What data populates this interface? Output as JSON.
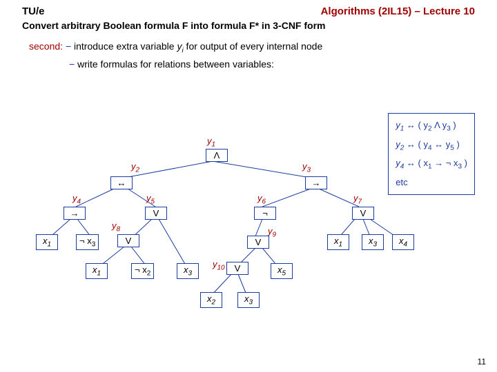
{
  "header": {
    "org": "TU/e",
    "course": "Algorithms (2IL15) – Lecture 10"
  },
  "title": "Convert arbitrary Boolean formula F into formula F* in 3-CNF form",
  "step": {
    "label": "second:",
    "b1": "introduce extra variable ",
    "b1_var": "y",
    "b1_sub": "i",
    "b1_tail": " for output of every internal node",
    "b2": "write formulas for relations between variables:"
  },
  "formulas": {
    "f1a": "y",
    "f1as": "1",
    "f1b": " ↔ ( y",
    "f1bs": "2",
    "f1c": " Λ y",
    "f1cs": "3",
    "f1d": " )",
    "f2a": "y",
    "f2as": "2",
    "f2b": " ↔ ( y",
    "f2bs": "4",
    "f2c": " ↔ y",
    "f2cs": "5",
    "f2d": " )",
    "f3a": "y",
    "f3as": "4",
    "f3b": " ↔ ( x",
    "f3bs": "1",
    "f3c": " → ¬ x",
    "f3cs": "3",
    "f3d": " )",
    "etc": "etc"
  },
  "y": {
    "y1": "y",
    "y1s": "1",
    "y2": "y",
    "y2s": "2",
    "y3": "y",
    "y3s": "3",
    "y4": "y",
    "y4s": "4",
    "y5": "y",
    "y5s": "5",
    "y6": "y",
    "y6s": "6",
    "y7": "y",
    "y7s": "7",
    "y8": "y",
    "y8s": "8",
    "y9": "y",
    "y9s": "9",
    "y10": "y",
    "y10s": "10"
  },
  "n": {
    "and": "Λ",
    "biimp": "↔",
    "imp": "→",
    "neg": "¬",
    "or": "V",
    "x1": "x",
    "x1s": "1",
    "nx3": "¬ x",
    "nx3s": "3",
    "nx2": "¬ x",
    "nx2s": "2",
    "x3": "x",
    "x3s": "3",
    "x2": "x",
    "x2s": "2",
    "x5": "x",
    "x5s": "5",
    "x4": "x",
    "x4s": "4"
  },
  "page": "11"
}
